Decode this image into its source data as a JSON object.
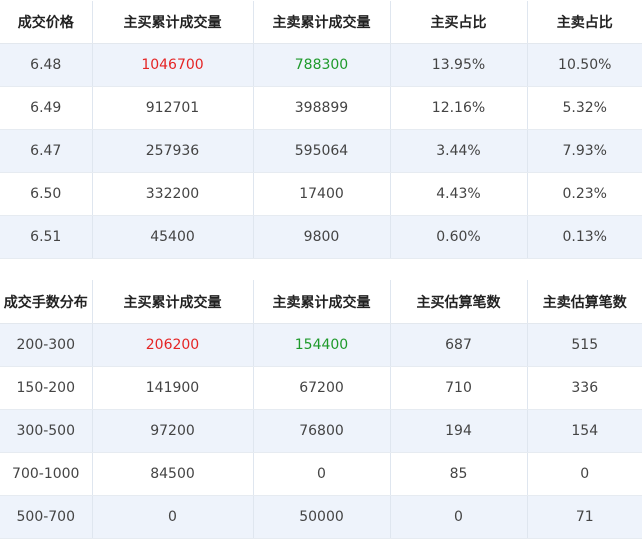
{
  "price_table": {
    "headers": [
      "成交价格",
      "主买累计成交量",
      "主卖累计成交量",
      "主买占比",
      "主卖占比"
    ],
    "rows": [
      [
        "6.48",
        "1046700",
        "788300",
        "13.95%",
        "10.50%"
      ],
      [
        "6.49",
        "912701",
        "398899",
        "12.16%",
        "5.32%"
      ],
      [
        "6.47",
        "257936",
        "595064",
        "3.44%",
        "7.93%"
      ],
      [
        "6.50",
        "332200",
        "17400",
        "4.43%",
        "0.23%"
      ],
      [
        "6.51",
        "45400",
        "9800",
        "0.60%",
        "0.13%"
      ]
    ]
  },
  "lot_table": {
    "headers": [
      "成交手数分布",
      "主买累计成交量",
      "主卖累计成交量",
      "主买估算笔数",
      "主卖估算笔数"
    ],
    "rows": [
      [
        "200-300",
        "206200",
        "154400",
        "687",
        "515"
      ],
      [
        "150-200",
        "141900",
        "67200",
        "710",
        "336"
      ],
      [
        "300-500",
        "97200",
        "76800",
        "194",
        "154"
      ],
      [
        "700-1000",
        "84500",
        "0",
        "85",
        "0"
      ],
      [
        "500-700",
        "0",
        "50000",
        "0",
        "71"
      ]
    ]
  },
  "colors": {
    "buy_highlight": "#e52525",
    "sell_highlight": "#1f9a2b",
    "stripe": "#eef3fb"
  }
}
